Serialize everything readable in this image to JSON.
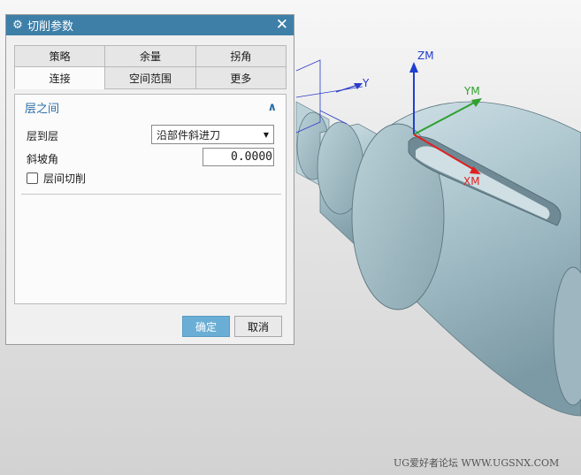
{
  "dialog": {
    "title": "切削参数",
    "close_glyph": "✕",
    "gear_glyph": "⚙",
    "tabs_row1": [
      "策略",
      "余量",
      "拐角"
    ],
    "tabs_row2": [
      "连接",
      "空间范围",
      "更多"
    ],
    "active_tab": "连接",
    "section": {
      "title": "层之间",
      "collapse_glyph": "∧"
    },
    "fields": {
      "layer_to_layer_label": "层到层",
      "layer_to_layer_value": "沿部件斜进刀",
      "ramp_angle_label": "斜坡角",
      "ramp_angle_value": "0.0000",
      "inter_layer_cut_label": "层间切削",
      "inter_layer_cut_checked": false
    },
    "buttons": {
      "ok": "确定",
      "cancel": "取消"
    }
  },
  "viewport": {
    "axes": {
      "zm": "ZM",
      "ym": "YM",
      "xm": "XM",
      "y": "Y"
    },
    "colors": {
      "part_body": "#a8c3cc",
      "axis_z": "#1f3fd0",
      "axis_y": "#2fa02f",
      "axis_x": "#e02020"
    }
  },
  "watermark": "UG爱好者论坛 WWW.UGSNX.COM",
  "icons": [
    "gear-icon",
    "close-icon",
    "chevron-up-icon",
    "dropdown-arrow-icon"
  ]
}
